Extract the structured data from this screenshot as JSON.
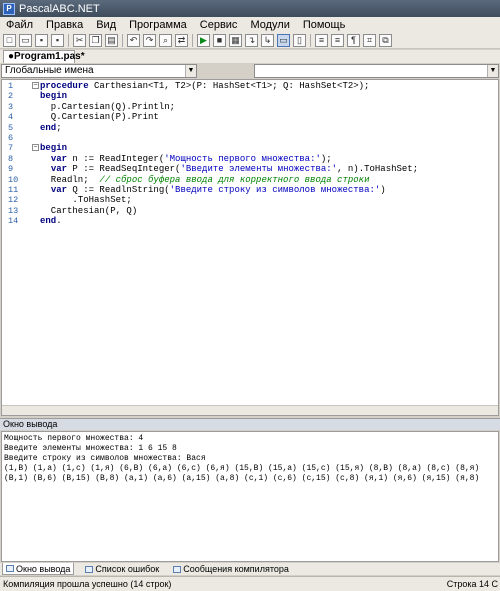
{
  "window": {
    "title": "PascalABC.NET"
  },
  "menu": [
    "Файл",
    "Правка",
    "Вид",
    "Программа",
    "Сервис",
    "Модули",
    "Помощь"
  ],
  "tab": {
    "label": "●Program1.pas*"
  },
  "scope_combo": {
    "value": "Глобальные имена"
  },
  "code_lines": [
    {
      "n": "1",
      "fold": "−",
      "parts": [
        {
          "t": "procedure ",
          "c": "kw"
        },
        {
          "t": "Carthesian<T1, T2>(P: HashSet<T1>; Q: HashSet<T2>);",
          "c": ""
        }
      ]
    },
    {
      "n": "2",
      "fold": "",
      "parts": [
        {
          "t": "begin",
          "c": "kw"
        }
      ]
    },
    {
      "n": "3",
      "fold": "",
      "parts": [
        {
          "t": "  p.Cartesian(Q).Println;",
          "c": ""
        }
      ]
    },
    {
      "n": "4",
      "fold": "",
      "parts": [
        {
          "t": "  Q.Cartesian(P).Print",
          "c": ""
        }
      ]
    },
    {
      "n": "5",
      "fold": "",
      "parts": [
        {
          "t": "end",
          "c": "kw"
        },
        {
          "t": ";",
          "c": ""
        }
      ]
    },
    {
      "n": "6",
      "fold": "",
      "parts": []
    },
    {
      "n": "7",
      "fold": "−",
      "parts": [
        {
          "t": "begin",
          "c": "kw"
        }
      ]
    },
    {
      "n": "8",
      "fold": "",
      "parts": [
        {
          "t": "  ",
          "c": ""
        },
        {
          "t": "var ",
          "c": "kw"
        },
        {
          "t": "n := ReadInteger(",
          "c": ""
        },
        {
          "t": "'Мощность первого множества:'",
          "c": "str"
        },
        {
          "t": ");",
          "c": ""
        }
      ]
    },
    {
      "n": "9",
      "fold": "",
      "parts": [
        {
          "t": "  ",
          "c": ""
        },
        {
          "t": "var ",
          "c": "kw"
        },
        {
          "t": "P := ReadSeqInteger(",
          "c": ""
        },
        {
          "t": "'Введите элементы множества:'",
          "c": "str"
        },
        {
          "t": ", n).ToHashSet;",
          "c": ""
        }
      ]
    },
    {
      "n": "10",
      "fold": "",
      "parts": [
        {
          "t": "  Readln;  ",
          "c": ""
        },
        {
          "t": "// сброс буфера ввода для корректного ввода строки",
          "c": "cm"
        }
      ]
    },
    {
      "n": "11",
      "fold": "",
      "parts": [
        {
          "t": "  ",
          "c": ""
        },
        {
          "t": "var ",
          "c": "kw"
        },
        {
          "t": "Q := ReadlnString(",
          "c": ""
        },
        {
          "t": "'Введите строку из символов множества:'",
          "c": "str"
        },
        {
          "t": ")",
          "c": ""
        }
      ]
    },
    {
      "n": "12",
      "fold": "",
      "parts": [
        {
          "t": "      .ToHashSet;",
          "c": ""
        }
      ]
    },
    {
      "n": "13",
      "fold": "",
      "parts": [
        {
          "t": "  Carthesian(P, Q)",
          "c": ""
        }
      ]
    },
    {
      "n": "14",
      "fold": "",
      "parts": [
        {
          "t": "end",
          "c": "kw"
        },
        {
          "t": ".",
          "c": ""
        }
      ]
    }
  ],
  "output": {
    "header": "Окно вывода",
    "lines": [
      "Мощность первого множества: 4",
      "Введите элементы множества: 1 6 15 8",
      "Введите строку из символов множества: Вася",
      "(1,В) (1,а) (1,с) (1,я) (6,В) (6,а) (6,с) (6,я) (15,В) (15,а) (15,с) (15,я) (8,В) (8,а) (8,с) (8,я)",
      "(В,1) (В,6) (В,15) (В,8) (а,1) (а,6) (а,15) (а,8) (с,1) (с,6) (с,15) (с,8) (я,1) (я,6) (я,15) (я,8)"
    ]
  },
  "bottom_tabs": [
    "Окно вывода",
    "Список ошибок",
    "Сообщения компилятора"
  ],
  "status": {
    "left": "Компиляция прошла успешно (14 строк)",
    "right": "Строка  14  С"
  }
}
